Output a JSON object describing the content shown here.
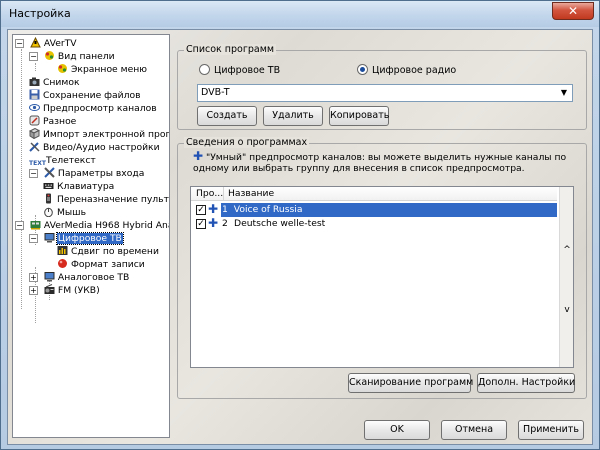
{
  "window": {
    "title": "Настройка",
    "close_glyph": "✕"
  },
  "tree": {
    "items": [
      {
        "label": "AVerTV"
      },
      {
        "label": "Вид панели"
      },
      {
        "label": "Экранное меню"
      },
      {
        "label": "Снимок"
      },
      {
        "label": "Сохранение файлов"
      },
      {
        "label": "Предпросмотр каналов"
      },
      {
        "label": "Разное"
      },
      {
        "label": "Импорт электронной прог"
      },
      {
        "label": "Видео/Аудио настройки"
      },
      {
        "label": "Телетекст"
      },
      {
        "label": "Параметры входа"
      },
      {
        "label": "Клавиатура"
      },
      {
        "label": "Переназначение пульт"
      },
      {
        "label": "Мышь"
      },
      {
        "label": "AVerMedia H968 Hybrid Ana"
      },
      {
        "label": "Цифровое ТВ"
      },
      {
        "label": "Сдвиг по времени"
      },
      {
        "label": "Формат записи"
      },
      {
        "label": "Аналоговое ТВ"
      },
      {
        "label": "FM (УКВ)"
      }
    ],
    "teletext_icon_text": "TEXT",
    "expander_minus": "−",
    "expander_plus": "+"
  },
  "program_list": {
    "group_label": "Список программ",
    "radio_digital_tv": "Цифровое ТВ",
    "radio_digital_radio": "Цифровое радио",
    "selected_radio": "digital_radio",
    "combo_value": "DVB-T",
    "combo_arrow": "▼",
    "create_button": "Создать",
    "delete_button": "Удалить",
    "copy_button": "Копировать"
  },
  "program_info": {
    "group_label": "Сведения о программах",
    "hint_plus": "✚",
    "hint_text": "\"Умный\" предпросмотр каналов: вы можете выделить нужные каналы по одному или выбрать группу для внесения в список предпросмотра.",
    "columns": [
      "Про...",
      "Название"
    ],
    "rows": [
      {
        "checked": true,
        "num": "1",
        "name": "Voice of Russia",
        "selected": true
      },
      {
        "checked": true,
        "num": "2",
        "name": "Deutsche welle-test",
        "selected": false
      }
    ],
    "check_glyph": "✓",
    "row_plus": "✚",
    "scroll_up": "^",
    "scroll_down": "v",
    "scan_button": "Сканирование программ",
    "extra_button": "Дополн. Настройки"
  },
  "footer": {
    "ok_button": "OK",
    "cancel_button": "Отмена",
    "apply_button": "Применить"
  },
  "colors": {
    "selection": "#3169c6",
    "accent_blue": "#2153b5"
  }
}
